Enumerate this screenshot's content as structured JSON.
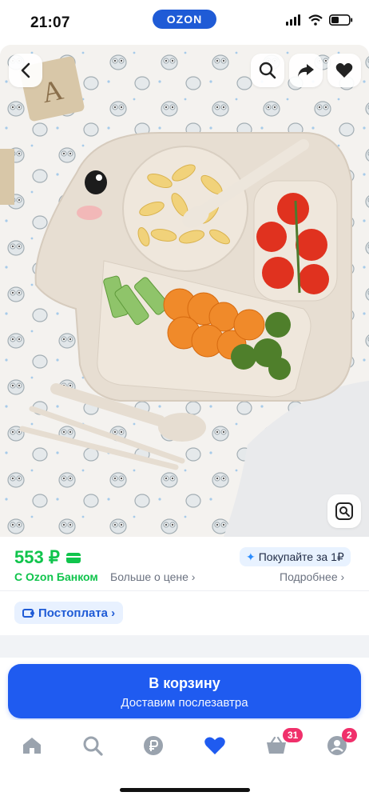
{
  "status_bar": {
    "time": "21:07",
    "brand_pill": "OZON"
  },
  "product": {
    "image_alt": "Elephant-shaped kids plate with pasta, tomatoes, cucumbers, carrots and broccoli",
    "buttons": {
      "back": "back",
      "search": "search",
      "share": "share",
      "favorite": "favorite",
      "lens": "image-search"
    }
  },
  "price": {
    "value": "553 ₽",
    "promo_badge": "Покупайте за 1₽",
    "ozon_bank": "С Ozon Банком",
    "more_about_price": "Больше о цене ›",
    "details": "Подробнее ›"
  },
  "postpay": {
    "label": "Постоплата ›"
  },
  "cta": {
    "title": "В корзину",
    "subtitle": "Доставим послезавтра"
  },
  "tabbar": {
    "cart_badge": "31",
    "profile_badge": "2"
  },
  "colors": {
    "accent": "#1f5bf0",
    "price_green": "#10c44c",
    "badge_pink": "#f0306b"
  }
}
